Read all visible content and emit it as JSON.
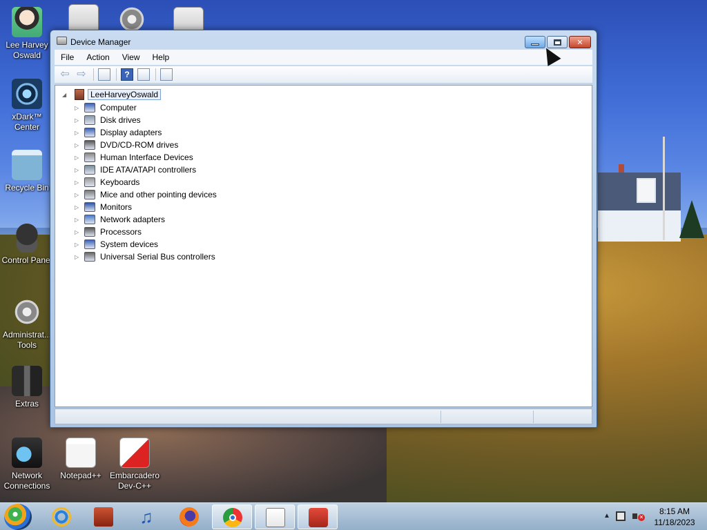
{
  "desktop": {
    "icons": [
      {
        "label": "Lee Harvey Oswald",
        "icon": "user-avatar-icon"
      },
      {
        "label": "xDark™ Center",
        "icon": "xdark-center-icon"
      },
      {
        "label": "Recycle Bin",
        "icon": "recycle-bin-icon"
      },
      {
        "label": "Control Panel",
        "icon": "control-panel-icon"
      },
      {
        "label": "Administrat... Tools",
        "icon": "administrative-tools-icon"
      },
      {
        "label": "Extras",
        "icon": "extras-icon"
      },
      {
        "label": "Network Connections",
        "icon": "network-connections-icon"
      },
      {
        "label": "Notepad++",
        "icon": "notepad-plus-plus-icon"
      },
      {
        "label": "Embarcadero Dev-C++",
        "icon": "dev-cpp-icon"
      }
    ]
  },
  "window": {
    "title": "Device Manager",
    "menu": [
      "File",
      "Action",
      "View",
      "Help"
    ],
    "tree": {
      "root": "LeeHarveyOswald",
      "items": [
        "Computer",
        "Disk drives",
        "Display adapters",
        "DVD/CD-ROM drives",
        "Human Interface Devices",
        "IDE ATA/ATAPI controllers",
        "Keyboards",
        "Mice and other pointing devices",
        "Monitors",
        "Network adapters",
        "Processors",
        "System devices",
        "Universal Serial Bus controllers"
      ]
    }
  },
  "taskbar": {
    "apps": [
      "internet-explorer-icon",
      "archive-icon",
      "music-player-icon",
      "firefox-icon",
      "chrome-icon",
      "notepad-plus-plus-icon",
      "toolbox-icon"
    ],
    "clock": {
      "time": "8:15 AM",
      "date": "11/18/2023"
    }
  }
}
